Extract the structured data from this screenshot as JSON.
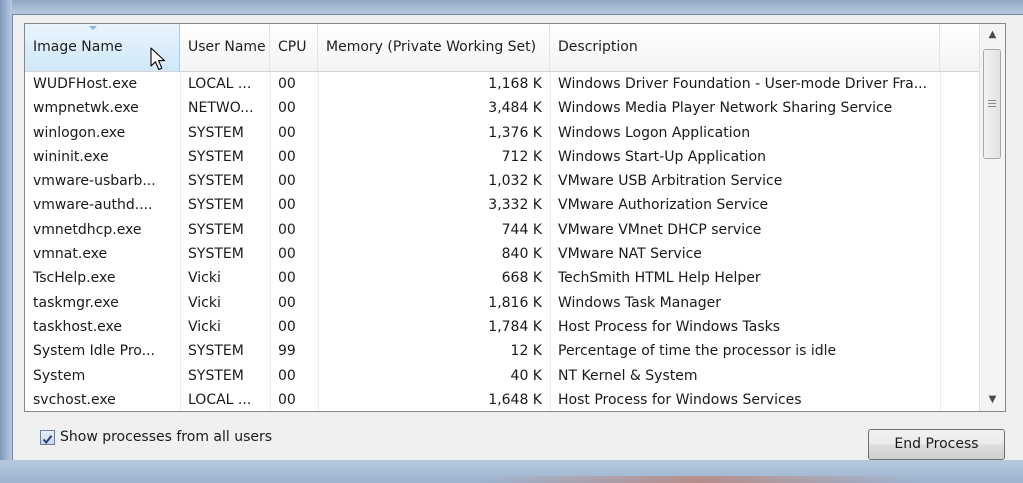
{
  "columns": {
    "image_name": "Image Name",
    "user_name": "User Name",
    "cpu": "CPU",
    "memory": "Memory (Private Working Set)",
    "description": "Description"
  },
  "processes": [
    {
      "image": "WUDFHost.exe",
      "user": "LOCAL ...",
      "cpu": "00",
      "memory": "1,168 K",
      "description": "Windows Driver Foundation - User-mode Driver Fra..."
    },
    {
      "image": "wmpnetwk.exe",
      "user": "NETWO...",
      "cpu": "00",
      "memory": "3,484 K",
      "description": "Windows Media Player Network Sharing Service"
    },
    {
      "image": "winlogon.exe",
      "user": "SYSTEM",
      "cpu": "00",
      "memory": "1,376 K",
      "description": "Windows Logon Application"
    },
    {
      "image": "wininit.exe",
      "user": "SYSTEM",
      "cpu": "00",
      "memory": "712 K",
      "description": "Windows Start-Up Application"
    },
    {
      "image": "vmware-usbarb...",
      "user": "SYSTEM",
      "cpu": "00",
      "memory": "1,032 K",
      "description": "VMware USB Arbitration Service"
    },
    {
      "image": "vmware-authd....",
      "user": "SYSTEM",
      "cpu": "00",
      "memory": "3,332 K",
      "description": "VMware Authorization Service"
    },
    {
      "image": "vmnetdhcp.exe",
      "user": "SYSTEM",
      "cpu": "00",
      "memory": "744 K",
      "description": "VMware VMnet DHCP service"
    },
    {
      "image": "vmnat.exe",
      "user": "SYSTEM",
      "cpu": "00",
      "memory": "840 K",
      "description": "VMware NAT Service"
    },
    {
      "image": "TscHelp.exe",
      "user": "Vicki",
      "cpu": "00",
      "memory": "668 K",
      "description": "TechSmith HTML Help Helper"
    },
    {
      "image": "taskmgr.exe",
      "user": "Vicki",
      "cpu": "00",
      "memory": "1,816 K",
      "description": "Windows Task Manager"
    },
    {
      "image": "taskhost.exe",
      "user": "Vicki",
      "cpu": "00",
      "memory": "1,784 K",
      "description": "Host Process for Windows Tasks"
    },
    {
      "image": "System Idle Pro...",
      "user": "SYSTEM",
      "cpu": "99",
      "memory": "12 K",
      "description": "Percentage of time the processor is idle"
    },
    {
      "image": "System",
      "user": "SYSTEM",
      "cpu": "00",
      "memory": "40 K",
      "description": "NT Kernel & System"
    },
    {
      "image": "svchost.exe",
      "user": "LOCAL ...",
      "cpu": "00",
      "memory": "1,648 K",
      "description": "Host Process for Windows Services"
    }
  ],
  "show_all_users": {
    "label": "Show processes from all users",
    "checked": true
  },
  "end_process_label": "End Process",
  "icons": {
    "check": "checkmark-icon",
    "scroll_up": "arrow-up-icon",
    "scroll_down": "arrow-down-icon",
    "cursor": "mouse-pointer-icon"
  },
  "colors": {
    "sorted_header": "#d0e8f9",
    "frame": "#a9bbd2"
  }
}
